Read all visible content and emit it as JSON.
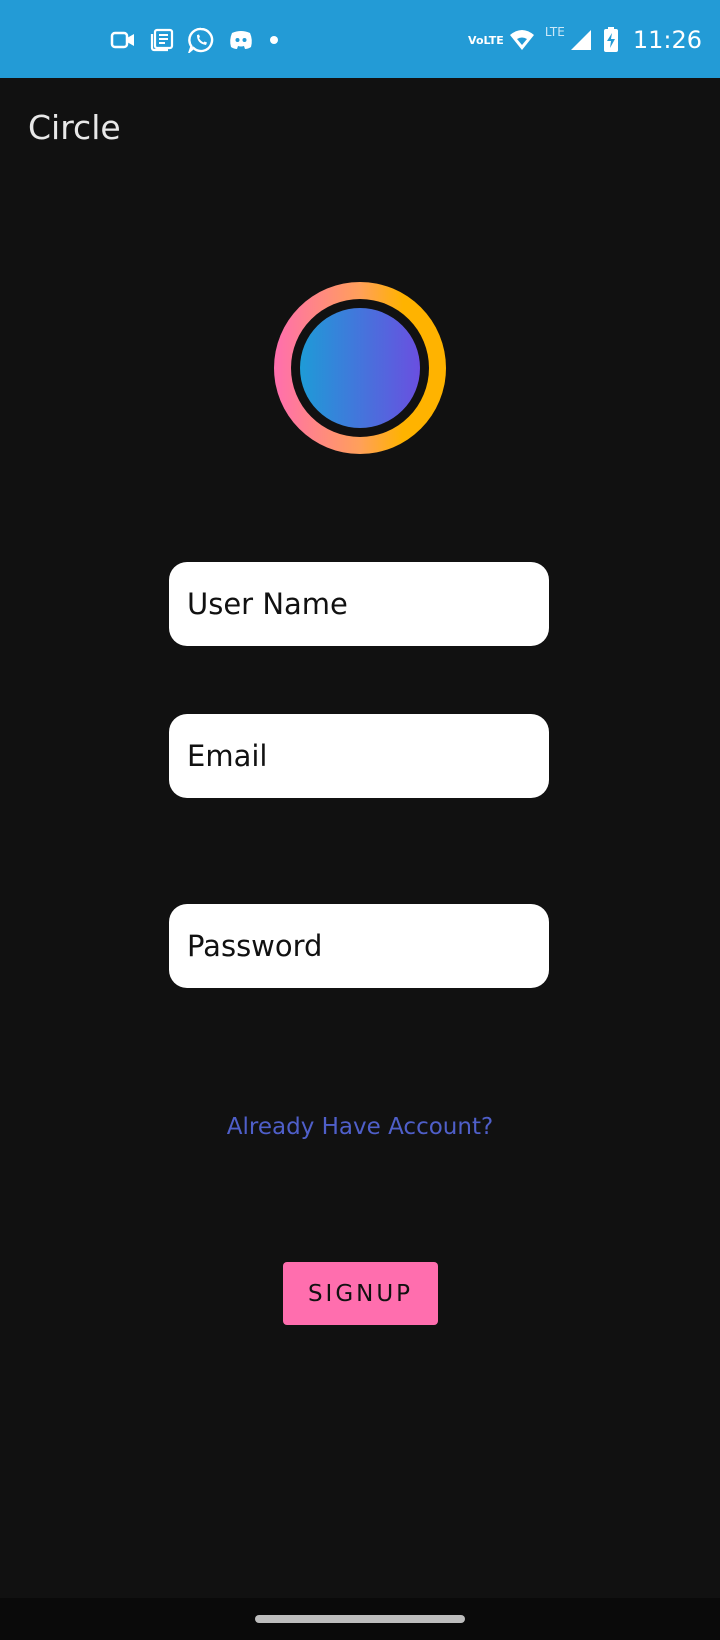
{
  "status_bar": {
    "time": "11:26",
    "volte_line1": "Vo",
    "volte_line2": "LTE",
    "network_label": "LTE",
    "left_icons": [
      "video-camera-icon",
      "news-icon",
      "whatsapp-icon",
      "discord-icon",
      "notification-dot-icon"
    ],
    "right_icons": [
      "volte-icon",
      "wifi-icon",
      "signal-icon",
      "battery-charging-icon"
    ],
    "background_color": "#239bd6"
  },
  "app_bar": {
    "title": "Circle"
  },
  "logo": {
    "icon": "circle-logo-icon",
    "ring_colors": [
      "#ff6eae",
      "#ffb300"
    ],
    "inner_colors": [
      "#1e9bd7",
      "#6a4fe0"
    ]
  },
  "form": {
    "username_placeholder": "User Name",
    "email_placeholder": "Email",
    "password_placeholder": "Password"
  },
  "login_link": "Already Have Account?",
  "signup_button": "SIGNUP",
  "colors": {
    "background": "#111111",
    "link": "#4f5fc9",
    "button": "#ff6eae"
  }
}
